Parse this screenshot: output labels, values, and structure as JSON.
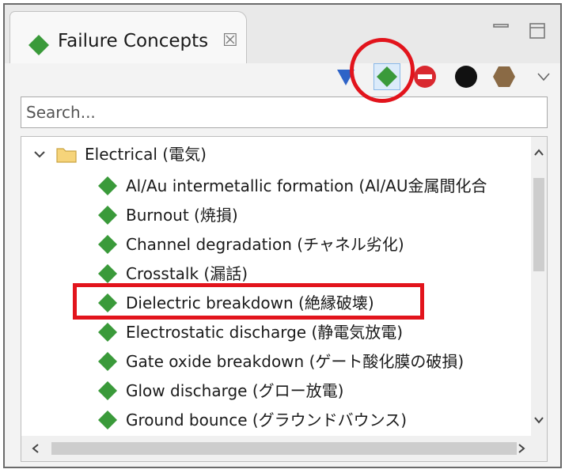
{
  "view": {
    "tab_title": "Failure Concepts",
    "close_glyph": "☒"
  },
  "toolbar": {
    "buttons": [
      {
        "icon": "blue-triangle-icon",
        "color": "#2e63c7"
      },
      {
        "icon": "green-diamond-icon",
        "color": "#3a9a3a",
        "active": true
      },
      {
        "icon": "red-no-entry-icon",
        "color": "#d9282f"
      },
      {
        "icon": "black-circle-icon",
        "color": "#111111"
      },
      {
        "icon": "brown-hexagon-icon",
        "color": "#8a6a45"
      },
      {
        "icon": "view-menu-icon",
        "color": "#666666"
      }
    ]
  },
  "search": {
    "placeholder": "Search..."
  },
  "tree": {
    "category": {
      "label": "Electrical (電気)",
      "expanded": true
    },
    "items": [
      {
        "label": "Al/Au intermetallic formation (Al/AU金属間化合"
      },
      {
        "label": "Burnout (焼損)"
      },
      {
        "label": "Channel degradation (チャネル劣化)"
      },
      {
        "label": "Crosstalk (漏話)"
      },
      {
        "label": "Dielectric breakdown (絶縁破壊)",
        "highlighted": true
      },
      {
        "label": "Electrostatic discharge (静電気放電)"
      },
      {
        "label": "Gate oxide breakdown (ゲート酸化膜の破損)"
      },
      {
        "label": "Glow discharge (グロー放電)"
      },
      {
        "label": "Ground bounce (グラウンドバウンス)"
      }
    ]
  },
  "colors": {
    "accent_red": "#e2141c",
    "diamond_green": "#3a9a3a",
    "folder_yellow": "#f6d47a"
  }
}
